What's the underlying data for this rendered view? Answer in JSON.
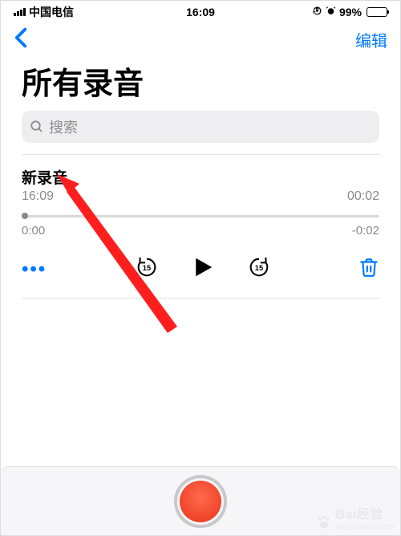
{
  "status": {
    "carrier": "中国电信",
    "time": "16:09",
    "battery_pct": "99%"
  },
  "nav": {
    "edit": "编辑"
  },
  "title": "所有录音",
  "search": {
    "placeholder": "搜索"
  },
  "recording": {
    "name": "新录音",
    "timestamp": "16:09",
    "duration": "00:02",
    "elapsed": "0:00",
    "remaining": "-0:02"
  },
  "watermark": {
    "main": "Bai经验",
    "sub": "jingyan.baidu.com"
  }
}
